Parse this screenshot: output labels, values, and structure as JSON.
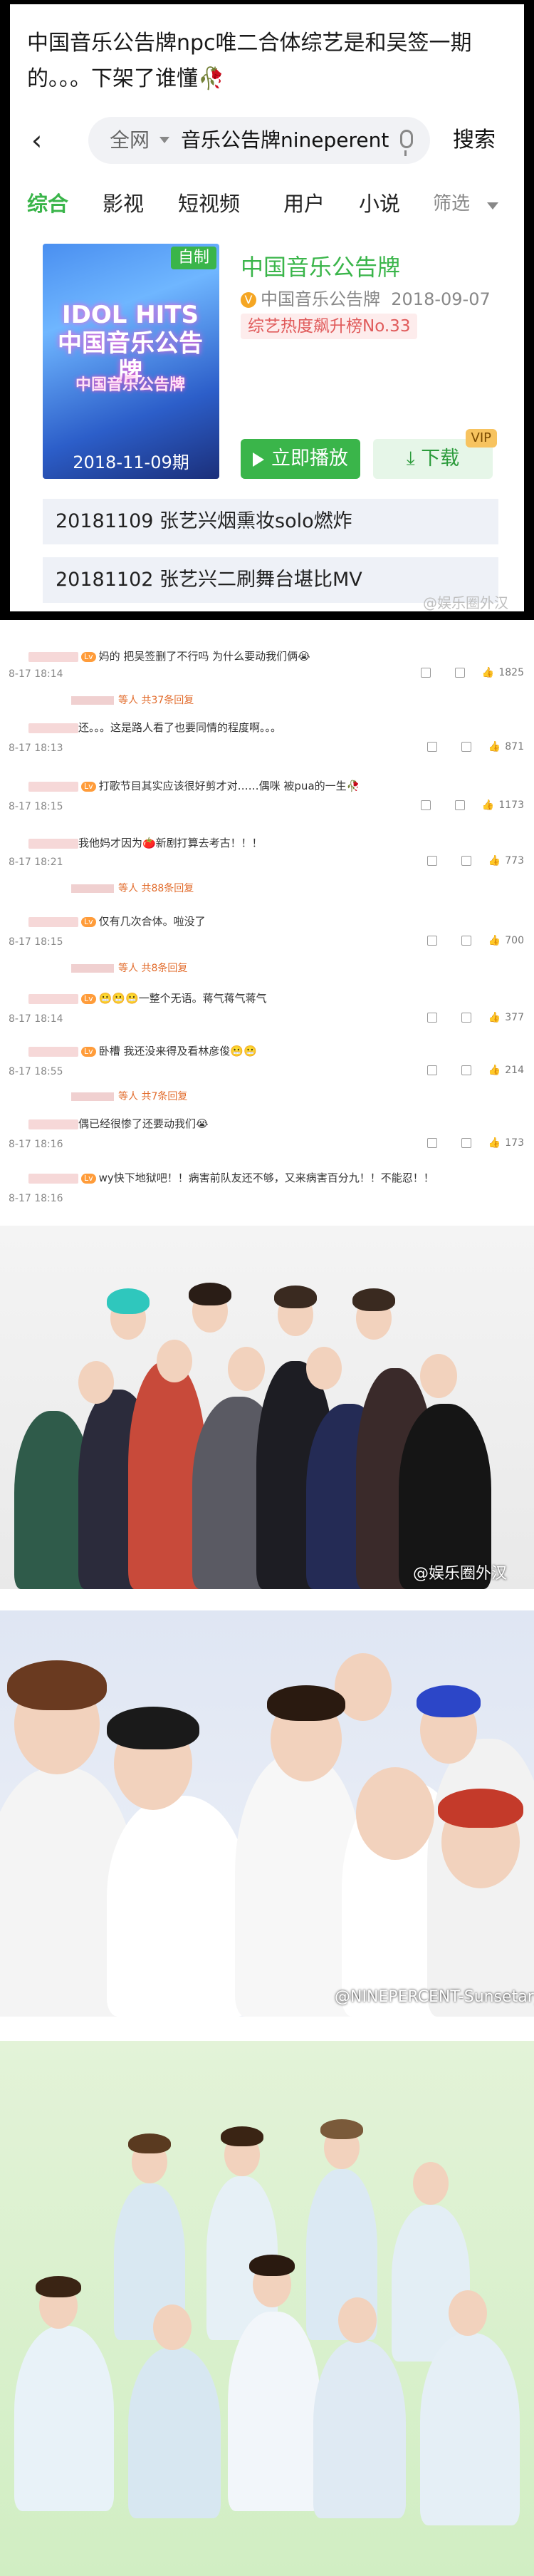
{
  "post": {
    "text": "中国音乐公告牌npc唯二合体综艺是和吴签一期的。。。下架了谁懂🥀"
  },
  "search": {
    "back_icon": "‹",
    "scope": "全网",
    "query": "音乐公告牌nineperent",
    "search_button": "搜索"
  },
  "tabs": [
    {
      "label": "综合",
      "active": true
    },
    {
      "label": "影视"
    },
    {
      "label": "短视频"
    },
    {
      "label": "用户"
    },
    {
      "label": "小说"
    },
    {
      "label": "筛选"
    }
  ],
  "result": {
    "badge": "自制",
    "poster_title": "IDOL HITS 中国音乐公告牌",
    "poster_sub": "中国音乐公告牌",
    "poster_date": "2018-11-09期",
    "title": "中国音乐公告牌",
    "channel": "中国音乐公告牌",
    "date": "2018-09-07",
    "rank_tag": "综艺热度飙升榜No.33",
    "play_label": "立即播放",
    "download_label": "下载",
    "vip_label": "VIP",
    "episodes": [
      "20181109 张艺兴烟熏妆solo燃炸",
      "20181102 张艺兴二刷舞台堪比MV"
    ],
    "watermark": "@娱乐圈外汉"
  },
  "comments": [
    {
      "text": "妈的 把吴签删了不行吗 为什么要动我们俩😭",
      "date": "8-17 18:14",
      "likes": "1825"
    },
    {
      "text": "等人 共37条回复",
      "reply": true
    },
    {
      "text": "还。。。这是路人看了也要同情的程度啊。。。",
      "date": "8-17 18:13",
      "likes": "871"
    },
    {
      "text": "打歌节目其实应该很好剪才对……偶咪 被pua的一生🥀",
      "date": "8-17 18:15",
      "likes": "1173"
    },
    {
      "text": "我他妈才因为🍅新剧打算去考古！！！",
      "date": "8-17 18:21",
      "likes": "773"
    },
    {
      "text": "等人 共88条回复",
      "reply": true
    },
    {
      "text": "仅有几次合体。啦没了",
      "date": "8-17 18:15",
      "likes": "700"
    },
    {
      "text": "等人 共8条回复",
      "reply": true
    },
    {
      "text": "😬😬😬一整个无语。蒋气蒋气蒋气",
      "date": "8-17 18:14",
      "likes": "377"
    },
    {
      "text": "卧槽 我还没来得及看林彦俊😬😬",
      "date": "8-17 18:55",
      "likes": "214"
    },
    {
      "text": "等人 共7条回复",
      "reply": true
    },
    {
      "text": "偶已经很惨了还要动我们😭",
      "date": "8-17 18:16",
      "likes": "173"
    },
    {
      "text": "wy快下地狱吧！！病害前队友还不够，又来病害百分九！！不能忍！！",
      "date": "8-17 18:16",
      "likes": ""
    }
  ],
  "photos": [
    {
      "caption": "@娱乐圈外汉"
    },
    {
      "caption": "@NINEPERCENT-Sunsetary"
    },
    {
      "caption": ""
    }
  ],
  "colors": {
    "accent_green": "#3ab54a",
    "rank_red": "#e05a5a",
    "vip_gold": "#f7c35f"
  }
}
